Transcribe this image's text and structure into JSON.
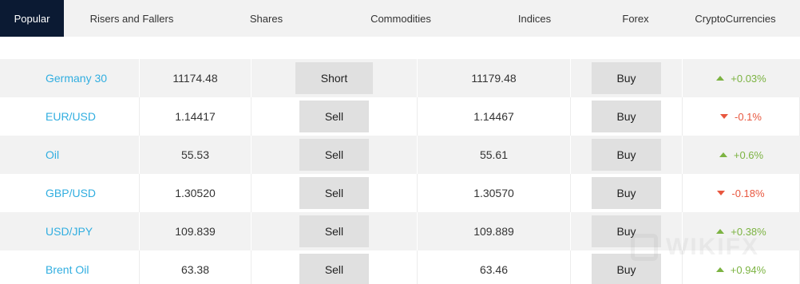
{
  "tabs": [
    {
      "label": "Popular",
      "active": true
    },
    {
      "label": "Risers and Fallers",
      "active": false
    },
    {
      "label": "Shares",
      "active": false
    },
    {
      "label": "Commodities",
      "active": false
    },
    {
      "label": "Indices",
      "active": false
    },
    {
      "label": "Forex",
      "active": false
    },
    {
      "label": "CryptoCurrencies",
      "active": false
    }
  ],
  "colors": {
    "active_tab_bg": "#0b1a33",
    "instrument_link": "#31aee0",
    "positive": "#7cb342",
    "negative": "#e8573f",
    "button_bg": "#e0e0e0"
  },
  "rows": [
    {
      "name": "Germany 30",
      "sell_price": "11174.48",
      "sell_label": "Short",
      "buy_price": "11179.48",
      "buy_label": "Buy",
      "change": "+0.03%",
      "direction": "up"
    },
    {
      "name": "EUR/USD",
      "sell_price": "1.14417",
      "sell_label": "Sell",
      "buy_price": "1.14467",
      "buy_label": "Buy",
      "change": "-0.1%",
      "direction": "down"
    },
    {
      "name": "Oil",
      "sell_price": "55.53",
      "sell_label": "Sell",
      "buy_price": "55.61",
      "buy_label": "Buy",
      "change": "+0.6%",
      "direction": "up"
    },
    {
      "name": "GBP/USD",
      "sell_price": "1.30520",
      "sell_label": "Sell",
      "buy_price": "1.30570",
      "buy_label": "Buy",
      "change": "-0.18%",
      "direction": "down"
    },
    {
      "name": "USD/JPY",
      "sell_price": "109.839",
      "sell_label": "Sell",
      "buy_price": "109.889",
      "buy_label": "Buy",
      "change": "+0.38%",
      "direction": "up"
    },
    {
      "name": "Brent Oil",
      "sell_price": "63.38",
      "sell_label": "Sell",
      "buy_price": "63.46",
      "buy_label": "Buy",
      "change": "+0.94%",
      "direction": "up"
    }
  ],
  "watermark": {
    "text": "WIKIFX"
  }
}
